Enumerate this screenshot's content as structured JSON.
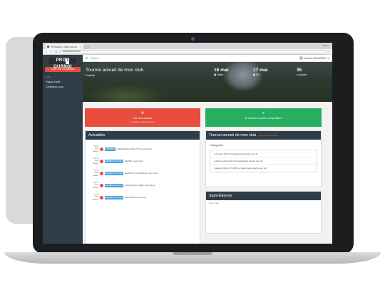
{
  "browser": {
    "tab_title": "ProTournoi - Créer une co...",
    "window_user": "Jérémie",
    "url": "www.protournoi.fr"
  },
  "sidebar": {
    "logo_left": "PRO",
    "logo_mid": "T",
    "logo_right": "OURNOI",
    "create_button": "Créer une compétition",
    "section_label": "AIDE",
    "items": [
      {
        "label": "Pages d'aide"
      },
      {
        "label": "Contactez-nous"
      }
    ]
  },
  "topbar": {
    "search_placeholder": "Search...",
    "user_name": "Jérémie BENAGENT"
  },
  "hero": {
    "title": "Tournoi annuel de mon club",
    "sport": "Football",
    "stats": [
      {
        "value": "16 mai",
        "label": "Début",
        "icon": "calendar-icon"
      },
      {
        "value": "17 mai",
        "label": "Fin",
        "icon": "calendar-icon"
      },
      {
        "value": "35",
        "label": "Inscrits",
        "icon": "users-icon"
      }
    ]
  },
  "actions": {
    "matches_title": "Voir les matchs",
    "matches_sub": "3 matchs restants à jouer",
    "register_title": "M'inscrire à cette compétition"
  },
  "news": {
    "title": "Actualités",
    "items": [
      {
        "time": "Il y a une heure",
        "badge": "POUSSIN",
        "text": "CHAZELLES-SUR-LYON s'est inscrit"
      },
      {
        "time": "Il y a une heure",
        "badge": "MINIME (U11-U12)",
        "text": "FEURS s'est inscrit"
      },
      {
        "time": "Il y a une heure",
        "badge": "MINIME (U11-U12)",
        "text": "MARCILLY-LE-CHATEL s'est inscrit"
      },
      {
        "time": "Il y a une heure",
        "badge": "MINIME (U11-U12)",
        "text": "USSON-EN-FOREZ s'est inscrit"
      },
      {
        "time": "Il y a une heure",
        "badge": "MINIME (U11-U12)",
        "text": "FRAISSES s'est inscrit"
      }
    ]
  },
  "tournament": {
    "title": "Tournoi annuel de mon club",
    "status": "Inscriptions ouvertes",
    "categories_label": "Catégories",
    "categories": [
      "» Poussin (U7) (11 participants inscrits sur 12)",
      "» Minime (U11-U12) (12 participants inscrits sur 12)",
      "» Espoir (U16-U17-U18) (12 participants inscrits sur 12)"
    ]
  },
  "city": {
    "title": "Saint-Étienne",
    "sub": "Voir le lieu"
  },
  "colors": {
    "sidebar": "#2f3d48",
    "red": "#e74c3c",
    "green": "#27ae60",
    "badge": "#4aa3df"
  }
}
